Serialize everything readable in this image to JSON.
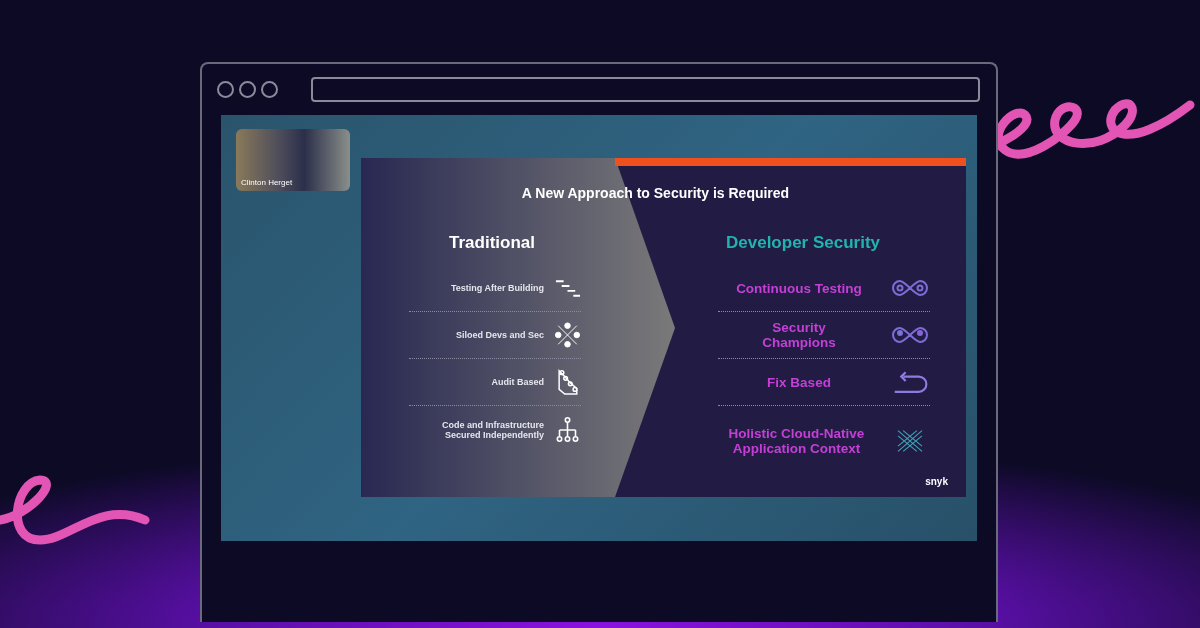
{
  "video_tile": {
    "name": "Clinton Herget"
  },
  "slide": {
    "title": "A New Approach to Security is Required",
    "left": {
      "heading": "Traditional",
      "items": [
        {
          "label": "Testing After Building"
        },
        {
          "label": "Siloed Devs and Sec"
        },
        {
          "label": "Audit Based"
        },
        {
          "label": "Code and Infrastructure Secured Independently"
        }
      ]
    },
    "right": {
      "heading": "Developer Security",
      "items": [
        {
          "label": "Continuous Testing"
        },
        {
          "label": "Security Champions"
        },
        {
          "label": "Fix Based"
        },
        {
          "label": "Holistic Cloud-Native Application Context"
        }
      ]
    },
    "logo": "snyk"
  }
}
